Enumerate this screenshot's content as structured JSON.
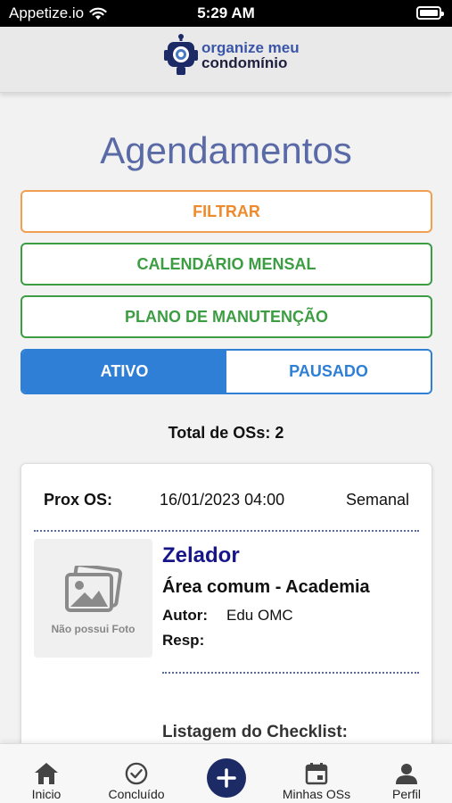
{
  "status_bar": {
    "carrier": "Appetize.io",
    "time": "5:29 AM"
  },
  "header": {
    "logo_line1": "organize meu",
    "logo_line2": "condomínio"
  },
  "page": {
    "title": "Agendamentos"
  },
  "buttons": {
    "filtrar": "FILTRAR",
    "calendario": "CALENDÁRIO MENSAL",
    "plano": "PLANO DE MANUTENÇÃO"
  },
  "segment": {
    "active": "ATIVO",
    "inactive": "PAUSADO",
    "selected": "ATIVO"
  },
  "summary": {
    "total": "Total de OSs: 2"
  },
  "card": {
    "prox_label": "Prox OS:",
    "prox_date": "16/01/2023 04:00",
    "frequency": "Semanal",
    "photo_caption": "Não possui Foto",
    "title": "Zelador",
    "area": "Área comum - Academia",
    "autor_label": "Autor:",
    "autor_value": "Edu OMC",
    "resp_label": "Resp:",
    "checklist_label": "Listagem do Checklist:"
  },
  "tabbar": {
    "items": [
      {
        "label": "Inicio",
        "icon": "home-icon"
      },
      {
        "label": "Concluído",
        "icon": "check-circle-icon"
      },
      {
        "label": "",
        "icon": "add-icon"
      },
      {
        "label": "Minhas OSs",
        "icon": "calendar-icon"
      },
      {
        "label": "Perfil",
        "icon": "person-icon"
      }
    ]
  },
  "colors": {
    "title": "#5a6aa6",
    "filtrar": "#ef8a2c",
    "green": "#3c9d43",
    "blue": "#2f7fd6",
    "navy": "#1c2a66",
    "os_title": "#16168a"
  }
}
